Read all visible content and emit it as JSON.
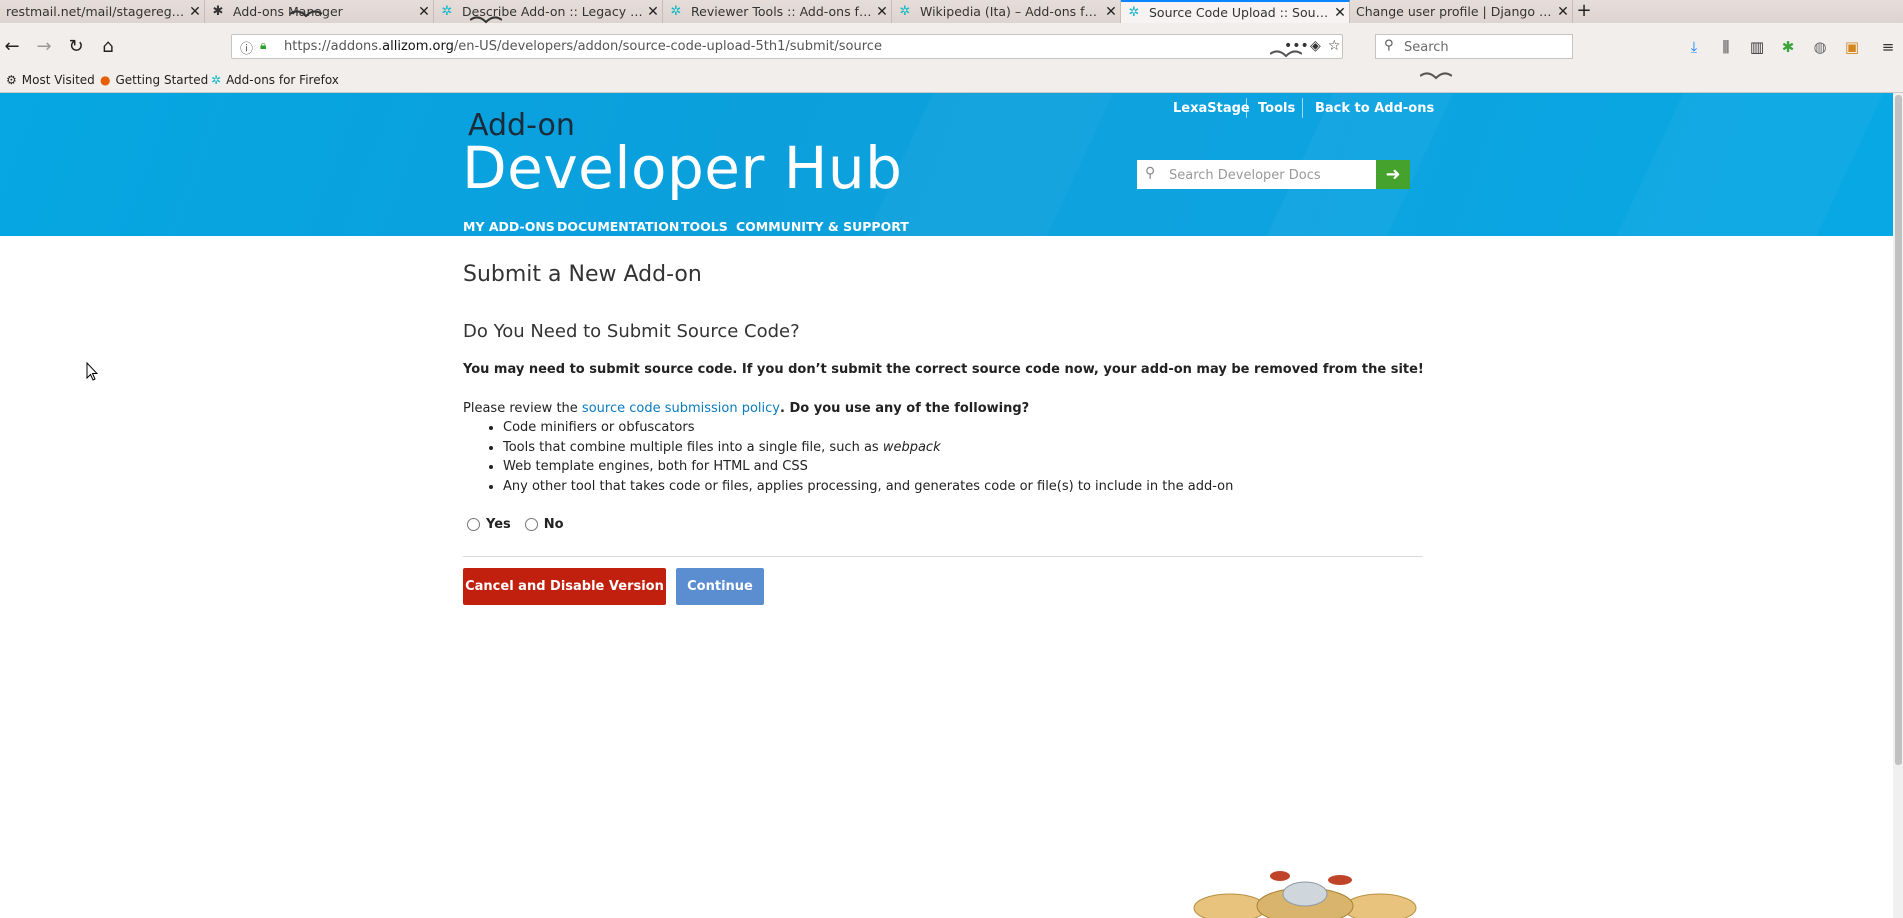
{
  "browser": {
    "tabs": [
      {
        "title": "restmail.net/mail/stageregister@re...",
        "icon": "mail-icon",
        "active": false
      },
      {
        "title": "Add-ons Manager",
        "icon": "puzzle-icon",
        "active": false
      },
      {
        "title": "Describe Add-on :: Legacy swit...",
        "icon": "amo-icon",
        "active": false
      },
      {
        "title": "Reviewer Tools :: Add-ons for F...",
        "icon": "amo-icon",
        "active": false
      },
      {
        "title": "Wikipedia (Ita) – Add-ons for Fi...",
        "icon": "amo-icon",
        "active": false
      },
      {
        "title": "Source Code Upload :: Source ...",
        "icon": "amo-icon",
        "active": true
      },
      {
        "title": "Change user profile | Django site ad...",
        "icon": "django-icon",
        "active": false
      }
    ],
    "url_prefix": "https://addons.",
    "url_domain": "allizom.org",
    "url_path": "/en-US/developers/addon/source-code-upload-5th1/submit/source",
    "search_placeholder": "Search",
    "bookmarks": [
      {
        "label": "Most Visited",
        "icon": "gear-icon"
      },
      {
        "label": "Getting Started",
        "icon": "firefox-icon"
      },
      {
        "label": "Add-ons for Firefox",
        "icon": "amo-icon"
      }
    ]
  },
  "header": {
    "title_small": "Add-on",
    "title_big": "Developer Hub",
    "top_links": [
      "LexaStage",
      "Tools",
      "Back to Add-ons"
    ],
    "search_placeholder": "Search Developer Docs",
    "nav": [
      "MY ADD-ONS",
      "DOCUMENTATION",
      "TOOLS",
      "COMMUNITY & SUPPORT"
    ]
  },
  "main": {
    "page_title": "Submit a New Add-on",
    "section_title": "Do You Need to Submit Source Code?",
    "warning": "You may need to submit source code. If you don’t submit the correct source code now, your add-on may be removed from the site!",
    "review_prefix": "Please review the ",
    "policy_link": "source code submission policy",
    "review_suffix": ". Do you use any of the following?",
    "tools": [
      "Code minifiers or obfuscators",
      "Tools that combine multiple files into a single file, such as ",
      "Web template engines, both for HTML and CSS",
      "Any other tool that takes code or files, applies processing, and generates code or file(s) to include in the add-on"
    ],
    "tools_italic": "webpack",
    "option_yes": "Yes",
    "option_no": "No",
    "cancel_button": "Cancel and Disable Version",
    "continue_button": "Continue"
  },
  "colors": {
    "hero": "#06a7e2",
    "cancel": "#c1200f",
    "continue": "#5b8ed0",
    "search_go": "#45a32d",
    "link": "#0a7bbf"
  }
}
